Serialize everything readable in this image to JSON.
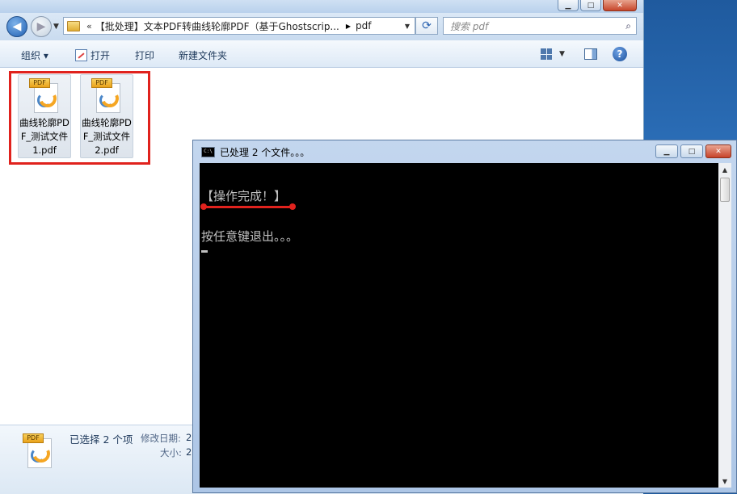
{
  "explorer": {
    "window_controls": {
      "minimize": "▁",
      "maximize": "□",
      "close": "✕"
    },
    "nav": {
      "back_icon": "◀",
      "forward_icon": "▶",
      "history_icon": "▼"
    },
    "address": {
      "chevron": "«",
      "crumb": "【批处理】文本PDF转曲线轮廓PDF（基于Ghostscrip...",
      "separator": "▶",
      "current": "pdf",
      "dropdown": "▼"
    },
    "refresh_icon": "⟳",
    "search": {
      "placeholder": "搜索 pdf",
      "icon": "⌕"
    },
    "toolbar": {
      "organize": "组织 ▾",
      "open": "打开",
      "print": "打印",
      "new_folder": "新建文件夹",
      "view_dropdown": "▼",
      "help": "?"
    },
    "files": [
      {
        "label": "曲线轮廓PDF_测试文件1.pdf",
        "icon": "pdf-file-icon",
        "tag": "PDF"
      },
      {
        "label": "曲线轮廓PDF_测试文件2.pdf",
        "icon": "pdf-file-icon",
        "tag": "PDF"
      }
    ],
    "details": {
      "count": "已选择 2 个项",
      "modified_label": "修改日期:",
      "modified_value": "2",
      "size_label": "大小:",
      "size_value": "2",
      "tag": "PDF"
    }
  },
  "console": {
    "title": "已处理 2 个文件。。。",
    "icon_text": "C:\\",
    "controls": {
      "minimize": "▁",
      "maximize": "□",
      "close": "✕"
    },
    "line1": "【操作完成！】",
    "line2": "按任意键退出。。。",
    "scroll_up": "▲",
    "scroll_down": "▼"
  },
  "colors": {
    "annotation_red": "#e0221d",
    "console_bg": "#000000",
    "console_text": "#c0c0c0"
  }
}
